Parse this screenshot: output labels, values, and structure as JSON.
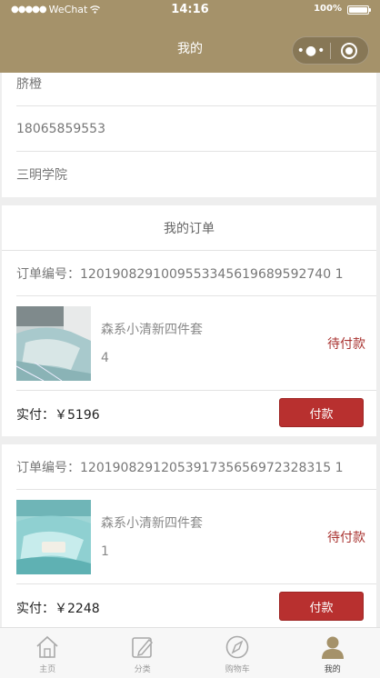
{
  "status_bar": {
    "carrier_dots": "●●●●●",
    "carrier": "WeChat",
    "time": "14:16",
    "battery": "100%"
  },
  "nav": {
    "title": "我的",
    "more_glyph": "•●•"
  },
  "profile": {
    "name": "脐橙",
    "phone": "18065859553",
    "school": "三明学院"
  },
  "orders": {
    "title": "我的订单",
    "list": [
      {
        "order_no": "订单编号：1201908291009553345619689592740 1",
        "item_name": "森系小清新四件套",
        "quantity": "4",
        "status": "待付款",
        "total": "实付：￥5196",
        "pay_label": "付款"
      },
      {
        "order_no": "订单编号：1201908291205391735656972328315 1",
        "item_name": "森系小清新四件套",
        "quantity": "1",
        "status": "待付款",
        "total": "实付：￥2248",
        "pay_label": "付款"
      }
    ]
  },
  "tabbar": {
    "items": [
      {
        "label": "主页",
        "icon": "home-icon"
      },
      {
        "label": "分类",
        "icon": "edit-icon"
      },
      {
        "label": "购物车",
        "icon": "compass-icon"
      },
      {
        "label": "我的",
        "icon": "user-icon"
      }
    ]
  },
  "colors": {
    "theme": "#a5926a",
    "accent": "#b8302f",
    "status": "#a8322f"
  }
}
